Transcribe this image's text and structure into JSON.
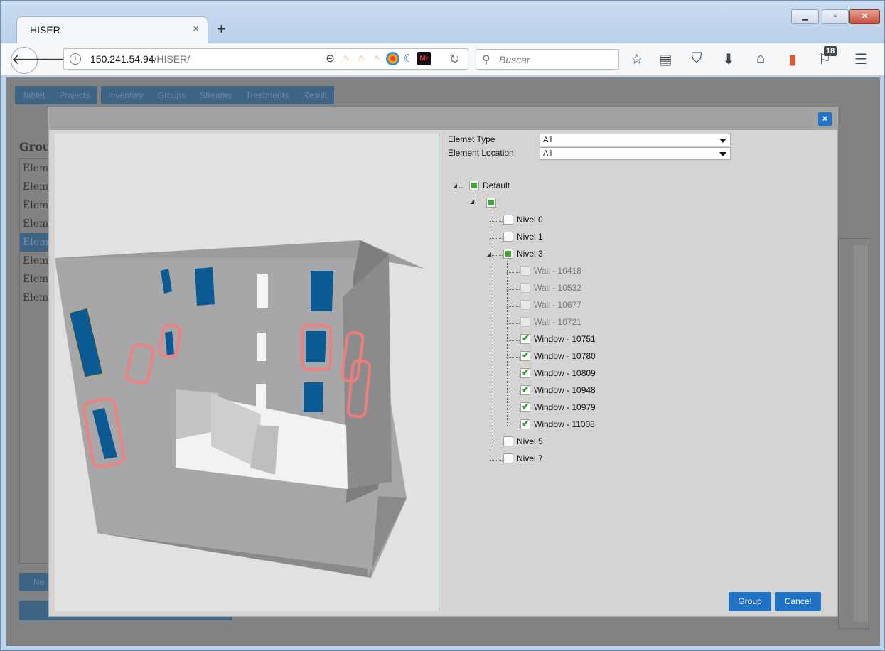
{
  "browser": {
    "tab_title": "HISER",
    "tab_close": "×",
    "new_tab": "+",
    "url_host": "150.241.54.94",
    "url_path": "/HISER/",
    "search_placeholder": "Buscar",
    "notification_count": "18"
  },
  "background_page": {
    "nav_group_1": [
      "Tablet",
      "Projects"
    ],
    "nav_group_2": [
      "Inventory",
      "Groups",
      "Streams",
      "Treatments",
      "Result"
    ],
    "heading": "Grou",
    "list_items": [
      "Eleme",
      "Eleme",
      "Eleme",
      "Eleme",
      "Eleme",
      "Eleme",
      "Eleme",
      "Eleme"
    ],
    "button_label": "Ne"
  },
  "modal": {
    "close_label": "×",
    "filters": {
      "element_type_label": "Elemet Type",
      "element_type_value": "All",
      "element_location_label": "Element Location",
      "element_location_value": "All"
    },
    "tree": {
      "root": "Default",
      "levels": [
        {
          "label": "Nivel 0"
        },
        {
          "label": "Nivel 1"
        },
        {
          "label": "Nivel 3"
        },
        {
          "label": "Nivel 5"
        },
        {
          "label": "Nivel 7"
        }
      ],
      "nivel3_children": [
        {
          "label": "Wall - 10418",
          "checked": false,
          "disabled": true
        },
        {
          "label": "Wall - 10532",
          "checked": false,
          "disabled": true
        },
        {
          "label": "Wall - 10677",
          "checked": false,
          "disabled": true
        },
        {
          "label": "Wall - 10721",
          "checked": false,
          "disabled": true
        },
        {
          "label": "Window - 10751",
          "checked": true,
          "disabled": false
        },
        {
          "label": "Window - 10780",
          "checked": true,
          "disabled": false
        },
        {
          "label": "Window - 10809",
          "checked": true,
          "disabled": false
        },
        {
          "label": "Window - 10948",
          "checked": true,
          "disabled": false
        },
        {
          "label": "Window - 10979",
          "checked": true,
          "disabled": false
        },
        {
          "label": "Window - 11008",
          "checked": true,
          "disabled": false
        }
      ]
    },
    "buttons": {
      "group": "Group",
      "cancel": "Cancel"
    }
  },
  "colors": {
    "accent": "#1e73c6",
    "check_green": "#3aa832",
    "window_blue": "#0b5a94",
    "highlight": "#ff7070"
  }
}
